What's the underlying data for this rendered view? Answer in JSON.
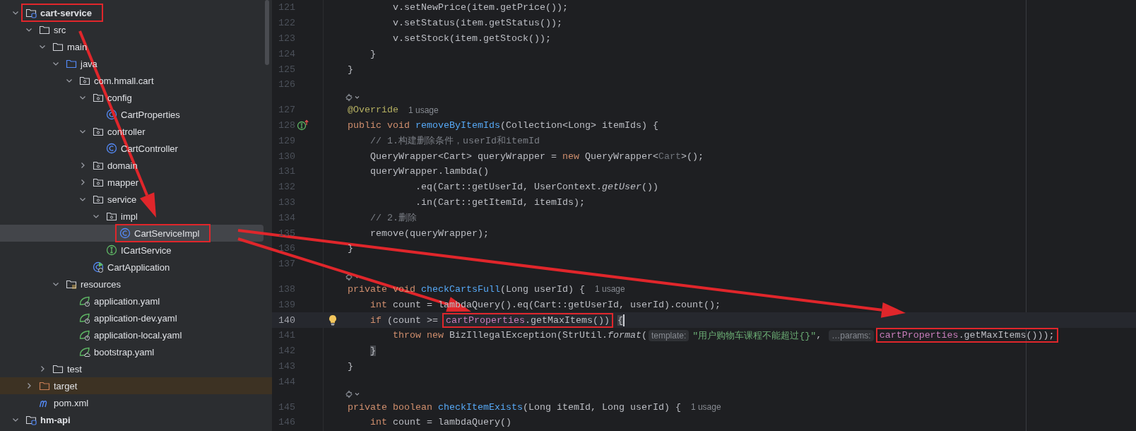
{
  "project_tree": [
    {
      "label": "cart-service",
      "kind": "module",
      "expanded": true,
      "selected": false,
      "boxed": true,
      "children": [
        {
          "label": "src",
          "kind": "folder",
          "expanded": true,
          "selected": false,
          "children": [
            {
              "label": "main",
              "kind": "folder",
              "expanded": true,
              "selected": false,
              "children": [
                {
                  "label": "java",
                  "kind": "source-folder",
                  "expanded": true,
                  "selected": false,
                  "children": [
                    {
                      "label": "com.hmall.cart",
                      "kind": "package",
                      "expanded": true,
                      "selected": false,
                      "children": [
                        {
                          "label": "config",
                          "kind": "package",
                          "expanded": true,
                          "selected": false,
                          "children": [
                            {
                              "label": "CartProperties",
                              "kind": "class",
                              "selected": false
                            }
                          ]
                        },
                        {
                          "label": "controller",
                          "kind": "package",
                          "expanded": true,
                          "selected": false,
                          "children": [
                            {
                              "label": "CartController",
                              "kind": "class",
                              "selected": false
                            }
                          ]
                        },
                        {
                          "label": "domain",
                          "kind": "package",
                          "expanded": false,
                          "selected": false
                        },
                        {
                          "label": "mapper",
                          "kind": "package",
                          "expanded": false,
                          "selected": false
                        },
                        {
                          "label": "service",
                          "kind": "package",
                          "expanded": true,
                          "selected": false,
                          "children": [
                            {
                              "label": "impl",
                              "kind": "package",
                              "expanded": true,
                              "selected": false,
                              "children": [
                                {
                                  "label": "CartServiceImpl",
                                  "kind": "class",
                                  "selected": true,
                                  "boxed": true
                                }
                              ]
                            },
                            {
                              "label": "ICartService",
                              "kind": "interface",
                              "selected": false
                            }
                          ]
                        },
                        {
                          "label": "CartApplication",
                          "kind": "app-class",
                          "selected": false
                        }
                      ]
                    }
                  ]
                },
                {
                  "label": "resources",
                  "kind": "resources",
                  "expanded": true,
                  "selected": false,
                  "children": [
                    {
                      "label": "application.yaml",
                      "kind": "spring-yaml",
                      "selected": false
                    },
                    {
                      "label": "application-dev.yaml",
                      "kind": "spring-yaml",
                      "selected": false
                    },
                    {
                      "label": "application-local.yaml",
                      "kind": "spring-yaml",
                      "selected": false
                    },
                    {
                      "label": "bootstrap.yaml",
                      "kind": "cloud-yaml",
                      "selected": false
                    }
                  ]
                }
              ]
            },
            {
              "label": "test",
              "kind": "folder",
              "expanded": false,
              "selected": false
            }
          ]
        },
        {
          "label": "target",
          "kind": "excluded-folder",
          "expanded": false,
          "selected": false
        },
        {
          "label": "pom.xml",
          "kind": "maven",
          "selected": false
        }
      ]
    },
    {
      "label": "hm-api",
      "kind": "module",
      "expanded": true,
      "selected": false
    }
  ],
  "editor": {
    "lines": [
      {
        "number": "121",
        "tokens": [
          {
            "kind": "plain",
            "text": "            v.setNewPrice(item.getPrice());"
          }
        ]
      },
      {
        "number": "122",
        "tokens": [
          {
            "kind": "plain",
            "text": "            v.setStatus(item.getStatus());"
          }
        ]
      },
      {
        "number": "123",
        "tokens": [
          {
            "kind": "plain",
            "text": "            v.setStock(item.getStock());"
          }
        ]
      },
      {
        "number": "124",
        "tokens": [
          {
            "kind": "plain",
            "text": "        }"
          }
        ]
      },
      {
        "number": "125",
        "tokens": [
          {
            "kind": "plain",
            "text": "    }"
          }
        ]
      },
      {
        "number": "126"
      },
      {
        "kind": "inlay"
      },
      {
        "number": "127",
        "tokens": [
          {
            "kind": "annotation",
            "text": "    @Override"
          },
          {
            "kind": "usage",
            "text": "1 usage"
          }
        ]
      },
      {
        "number": "128",
        "kind": "implementing",
        "tokens": [
          {
            "kind": "keyword",
            "text": "    public void "
          },
          {
            "kind": "method",
            "text": "removeByItemIds"
          },
          {
            "kind": "plain",
            "text": "(Collection<Long> itemIds) {"
          }
        ]
      },
      {
        "number": "129",
        "tokens": [
          {
            "kind": "comment",
            "text": "        // 1.构建删除条件，userId和itemId"
          }
        ]
      },
      {
        "number": "130",
        "tokens": [
          {
            "kind": "plain",
            "text": "        QueryWrapper<Cart> queryWrapper = "
          },
          {
            "kind": "keyword",
            "text": "new"
          },
          {
            "kind": "plain",
            "text": " QueryWrapper<"
          },
          {
            "kind": "dim",
            "text": "Cart"
          },
          {
            "kind": "plain",
            "text": ">();"
          }
        ]
      },
      {
        "number": "131",
        "tokens": [
          {
            "kind": "plain",
            "text": "        queryWrapper.lambda()"
          }
        ]
      },
      {
        "number": "132",
        "tokens": [
          {
            "kind": "plain",
            "text": "                .eq(Cart::getUserId, UserContext."
          },
          {
            "kind": "italic",
            "text": "getUser"
          },
          {
            "kind": "plain",
            "text": "())"
          }
        ]
      },
      {
        "number": "133",
        "tokens": [
          {
            "kind": "plain",
            "text": "                .in(Cart::getItemId, itemIds);"
          }
        ]
      },
      {
        "number": "134",
        "tokens": [
          {
            "kind": "comment",
            "text": "        // 2.删除"
          }
        ]
      },
      {
        "number": "135",
        "tokens": [
          {
            "kind": "plain",
            "text": "        remove(queryWrapper);"
          }
        ]
      },
      {
        "number": "136",
        "tokens": [
          {
            "kind": "plain",
            "text": "    }"
          }
        ]
      },
      {
        "number": "137"
      },
      {
        "kind": "inlay"
      },
      {
        "number": "138",
        "tokens": [
          {
            "kind": "keyword",
            "text": "    private void "
          },
          {
            "kind": "method",
            "text": "checkCartsFull"
          },
          {
            "kind": "plain",
            "text": "(Long userId) {"
          },
          {
            "kind": "usage",
            "text": "1 usage"
          }
        ]
      },
      {
        "number": "139",
        "tokens": [
          {
            "kind": "keyword",
            "text": "        int"
          },
          {
            "kind": "plain",
            "text": " count = lambdaQuery().eq(Cart::getUserId, userId).count();"
          }
        ]
      },
      {
        "number": "140",
        "kind": "intention",
        "current": true,
        "tokens": [
          {
            "kind": "keyword",
            "text": "        if"
          },
          {
            "kind": "plain",
            "text": " (count >= "
          },
          {
            "kind": "box",
            "tokens": [
              {
                "kind": "field",
                "text": "cartProperties"
              },
              {
                "kind": "plain",
                "text": ".getMaxItems())"
              }
            ]
          },
          {
            "kind": "brace",
            "text": " {"
          }
        ]
      },
      {
        "number": "141",
        "tokens": [
          {
            "kind": "keyword",
            "text": "            throw new"
          },
          {
            "kind": "plain",
            "text": " BizIllegalException(StrUtil."
          },
          {
            "kind": "italic",
            "text": "format"
          },
          {
            "kind": "plain",
            "text": "("
          },
          {
            "kind": "hint",
            "text": "template:"
          },
          {
            "kind": "string",
            "text": "\"用户购物车课程不能超过{}\""
          },
          {
            "kind": "plain",
            "text": ", "
          },
          {
            "kind": "hint",
            "text": "…params:"
          },
          {
            "kind": "box",
            "tokens": [
              {
                "kind": "field",
                "text": "cartProperties"
              },
              {
                "kind": "plain",
                "text": ".getMaxItems()));"
              }
            ]
          }
        ]
      },
      {
        "number": "142",
        "tokens": [
          {
            "kind": "brace",
            "text": "        }"
          }
        ]
      },
      {
        "number": "143",
        "tokens": [
          {
            "kind": "plain",
            "text": "    }"
          }
        ]
      },
      {
        "number": "144"
      },
      {
        "kind": "inlay"
      },
      {
        "number": "145",
        "tokens": [
          {
            "kind": "keyword",
            "text": "    private boolean "
          },
          {
            "kind": "method",
            "text": "checkItemExists"
          },
          {
            "kind": "plain",
            "text": "(Long itemId, Long userId) {"
          },
          {
            "kind": "usage",
            "text": "1 usage"
          }
        ]
      },
      {
        "number": "146",
        "tokens": [
          {
            "kind": "keyword",
            "text": "        int"
          },
          {
            "kind": "plain",
            "text": " count = lambdaQuery()"
          }
        ]
      }
    ]
  }
}
